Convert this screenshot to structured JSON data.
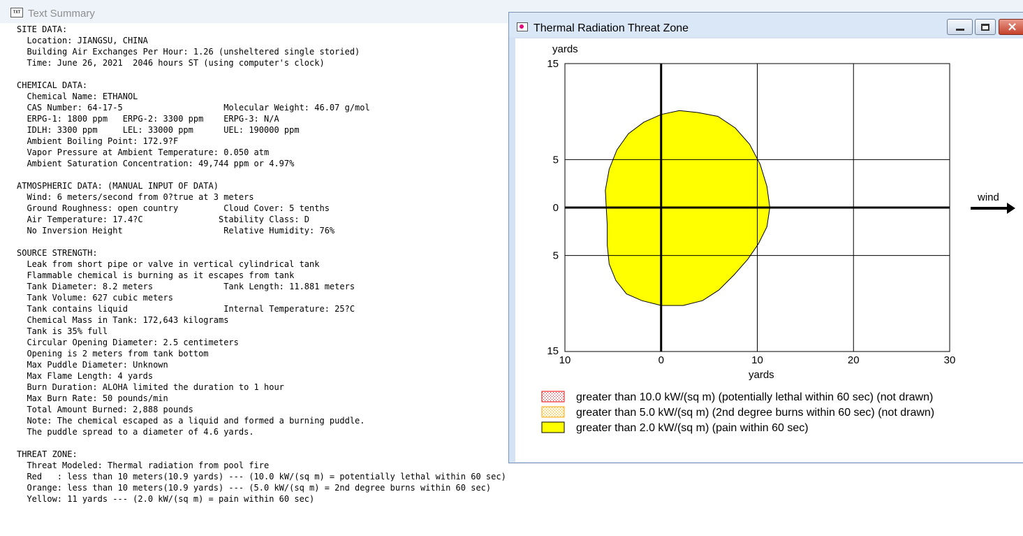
{
  "text_summary": {
    "title": "Text Summary",
    "icon": "text-summary-icon",
    "lines": [
      "SITE DATA:",
      "  Location: JIANGSU, CHINA",
      "  Building Air Exchanges Per Hour: 1.26 (unsheltered single storied)",
      "  Time: June 26, 2021  2046 hours ST (using computer's clock)",
      "",
      "CHEMICAL DATA:",
      "  Chemical Name: ETHANOL",
      "  CAS Number: 64-17-5                    Molecular Weight: 46.07 g/mol",
      "  ERPG-1: 1800 ppm   ERPG-2: 3300 ppm    ERPG-3: N/A",
      "  IDLH: 3300 ppm     LEL: 33000 ppm      UEL: 190000 ppm",
      "  Ambient Boiling Point: 172.9?F",
      "  Vapor Pressure at Ambient Temperature: 0.050 atm",
      "  Ambient Saturation Concentration: 49,744 ppm or 4.97%",
      "",
      "ATMOSPHERIC DATA: (MANUAL INPUT OF DATA)",
      "  Wind: 6 meters/second from 0?true at 3 meters",
      "  Ground Roughness: open country         Cloud Cover: 5 tenths",
      "  Air Temperature: 17.4?C               Stability Class: D",
      "  No Inversion Height                    Relative Humidity: 76%",
      "",
      "SOURCE STRENGTH:",
      "  Leak from short pipe or valve in vertical cylindrical tank",
      "  Flammable chemical is burning as it escapes from tank",
      "  Tank Diameter: 8.2 meters              Tank Length: 11.881 meters",
      "  Tank Volume: 627 cubic meters",
      "  Tank contains liquid                   Internal Temperature: 25?C",
      "  Chemical Mass in Tank: 172,643 kilograms",
      "  Tank is 35% full",
      "  Circular Opening Diameter: 2.5 centimeters",
      "  Opening is 2 meters from tank bottom",
      "  Max Puddle Diameter: Unknown",
      "  Max Flame Length: 4 yards",
      "  Burn Duration: ALOHA limited the duration to 1 hour",
      "  Max Burn Rate: 50 pounds/min",
      "  Total Amount Burned: 2,888 pounds",
      "  Note: The chemical escaped as a liquid and formed a burning puddle.",
      "  The puddle spread to a diameter of 4.6 yards.",
      "",
      "THREAT ZONE:",
      "  Threat Modeled: Thermal radiation from pool fire",
      "  Red   : less than 10 meters(10.9 yards) --- (10.0 kW/(sq m) = potentially lethal within 60 sec)",
      "  Orange: less than 10 meters(10.9 yards) --- (5.0 kW/(sq m) = 2nd degree burns within 60 sec)",
      "  Yellow: 11 yards --- (2.0 kW/(sq m) = pain within 60 sec)"
    ]
  },
  "threat_zone_window": {
    "title": "Thermal Radiation Threat Zone",
    "icon": "threat-zone-app-icon",
    "buttons": {
      "minimize": "minimize-icon",
      "maximize": "maximize-icon",
      "close": "×"
    },
    "wind_label": "wind"
  },
  "chart_data": {
    "type": "area",
    "x_axis": {
      "label": "yards",
      "range": [
        -10,
        30
      ],
      "ticks": [
        -10,
        0,
        10,
        20,
        30
      ],
      "tick_labels": [
        "10",
        "0",
        "10",
        "20",
        "30"
      ]
    },
    "y_axis": {
      "label": "yards",
      "range": [
        -15,
        15
      ],
      "ticks": [
        15,
        5,
        0,
        -5,
        -15
      ],
      "tick_labels": [
        "15",
        "5",
        "0",
        "5",
        "15"
      ]
    },
    "grid": true,
    "legend": [
      {
        "label": "greater than 10.0 kW/(sq m) (potentially lethal within 60 sec) (not drawn)",
        "color": "#ff0000",
        "pattern": "dotted"
      },
      {
        "label": "greater than 5.0 kW/(sq m) (2nd degree burns within 60 sec) (not drawn)",
        "color": "#ffa500",
        "pattern": "dotted"
      },
      {
        "label": "greater than 2.0 kW/(sq m) (pain within 60 sec)",
        "color": "#ffff00",
        "pattern": "solid"
      }
    ],
    "zones": [
      {
        "name": "greater than 2.0 kW/(sq m) (pain within 60 sec)",
        "color": "#ffff00",
        "x": [
          11.3,
          11.0,
          10.3,
          9.2,
          7.7,
          5.9,
          3.8,
          1.9,
          0,
          -1.8,
          -3.4,
          -4.6,
          -5.4,
          -5.8,
          -5.7,
          -5.6,
          -5.6,
          -5.4,
          -4.7,
          -3.6,
          -2.0,
          0,
          2.3,
          4.3,
          6.0,
          7.6,
          9.0,
          10.1,
          11.0,
          11.3
        ],
        "y": [
          0,
          2.2,
          4.5,
          6.6,
          8.3,
          9.5,
          9.9,
          10.1,
          9.7,
          8.9,
          7.7,
          6.0,
          4.0,
          1.8,
          0,
          -1.8,
          -3.9,
          -5.9,
          -7.6,
          -9.0,
          -9.7,
          -10.2,
          -10.2,
          -9.7,
          -8.6,
          -7.0,
          -5.4,
          -3.8,
          -2.0,
          0
        ]
      }
    ]
  }
}
